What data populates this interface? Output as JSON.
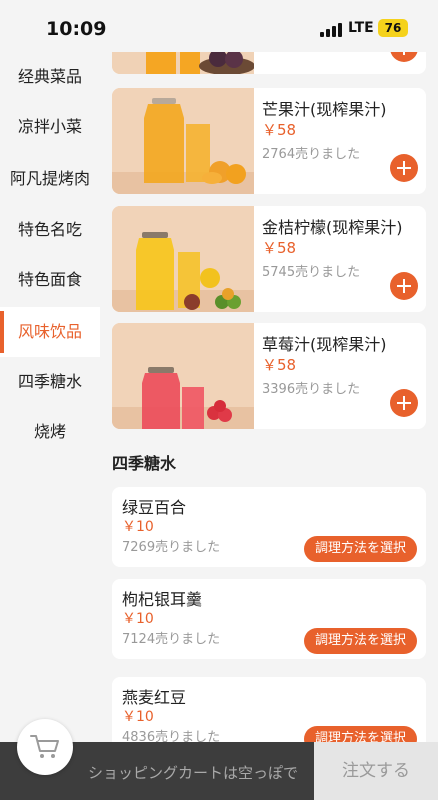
{
  "status_bar": {
    "time": "10:09",
    "network": "LTE",
    "battery": "76"
  },
  "sidebar": {
    "items": [
      {
        "label": "经典菜品"
      },
      {
        "label": "凉拌小菜"
      },
      {
        "label": "阿凡提烤肉"
      },
      {
        "label": "特色名吃"
      },
      {
        "label": "特色面食"
      },
      {
        "label": "风味饮品",
        "active": true
      },
      {
        "label": "四季糖水"
      },
      {
        "label": "烧烤"
      }
    ]
  },
  "drinks": [
    {
      "name": "芒果汁(现榨果汁)",
      "price": "￥58",
      "sold": "2764売りました",
      "image": "mango-juice-photo"
    },
    {
      "name": "金桔柠檬(现榨果汁)",
      "price": "￥58",
      "sold": "5745売りました",
      "image": "kumquat-lemon-photo"
    },
    {
      "name": "草莓汁(现榨果汁)",
      "price": "￥58",
      "sold": "3396売りました",
      "image": "strawberry-juice-photo"
    }
  ],
  "section_title": "四季糖水",
  "desserts": [
    {
      "name": "绿豆百合",
      "price": "￥10",
      "sold": "7269売りました",
      "button": "調理方法を選択"
    },
    {
      "name": "枸杞银耳羹",
      "price": "￥10",
      "sold": "7124売りました",
      "button": "調理方法を選択"
    },
    {
      "name": "燕麦红豆",
      "price": "￥10",
      "sold": "4836売りました",
      "button": "調理方法を選択"
    }
  ],
  "cart": {
    "empty_text": "ショッピングカートは空っぽで",
    "order_label": "注文する",
    "icon": "cart-icon"
  },
  "colors": {
    "accent": "#e8612c",
    "bottom_bar": "#3d3d3d"
  }
}
